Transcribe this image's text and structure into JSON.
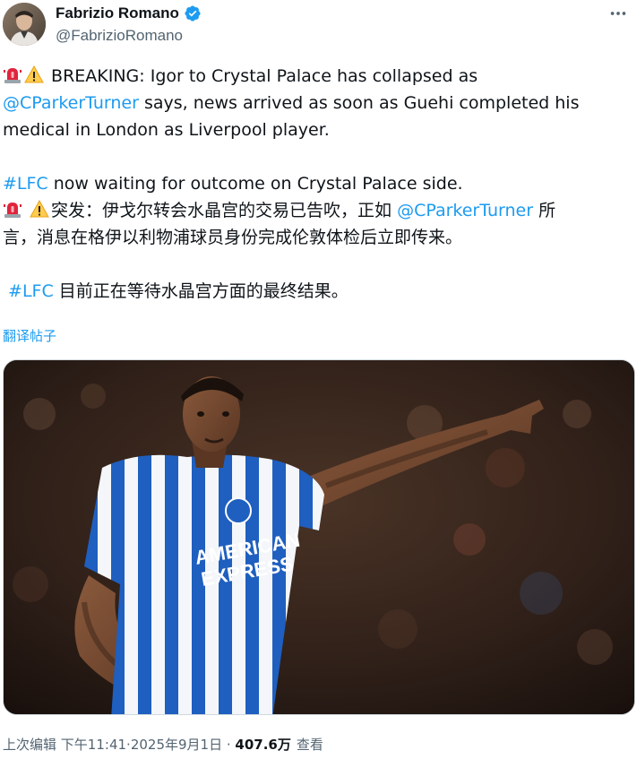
{
  "author": {
    "display_name": "Fabrizio Romano",
    "handle": "@FabrizioRomano",
    "verified_icon": "verified-badge-icon"
  },
  "menu": {
    "more_icon": "more-horizontal-icon"
  },
  "tweet": {
    "line1_text": "BREAKING: Igor to Crystal Palace has collapsed as",
    "mention1": "@CParkerTurner",
    "line2_rest": " says, news arrived as soon as Guehi completed his",
    "line3": "medical in London as Liverpool player.",
    "hashtag1": "#LFC",
    "line4_rest": " now waiting for outcome on Crystal Palace side.",
    "cn_line1_prefix": "突发：伊戈尔转会水晶宫的交易已告吹，正如 ",
    "cn_mention": "@CParkerTurner",
    "cn_line1_suffix": " 所",
    "cn_line2": "言，消息在格伊以利物浦球员身份完成伦敦体检后立即传来。",
    "cn_hashtag": "#LFC",
    "cn_line3_rest": " 目前正在等待水晶宫方面的最终结果。",
    "emoji1": "rotating-light-icon",
    "emoji2": "warning-icon"
  },
  "translate_label": "翻译帖子",
  "media": {
    "alt": "player-photo"
  },
  "footer": {
    "edited_label": "上次编辑",
    "time": "下午11:41",
    "dot": "·",
    "date": "2025年9月1日",
    "views_count": "407.6万",
    "views_label": "查看"
  },
  "colors": {
    "link": "#1d9bf0",
    "text": "#0f1419",
    "muted": "#536471",
    "verified": "#1d9bf0"
  }
}
